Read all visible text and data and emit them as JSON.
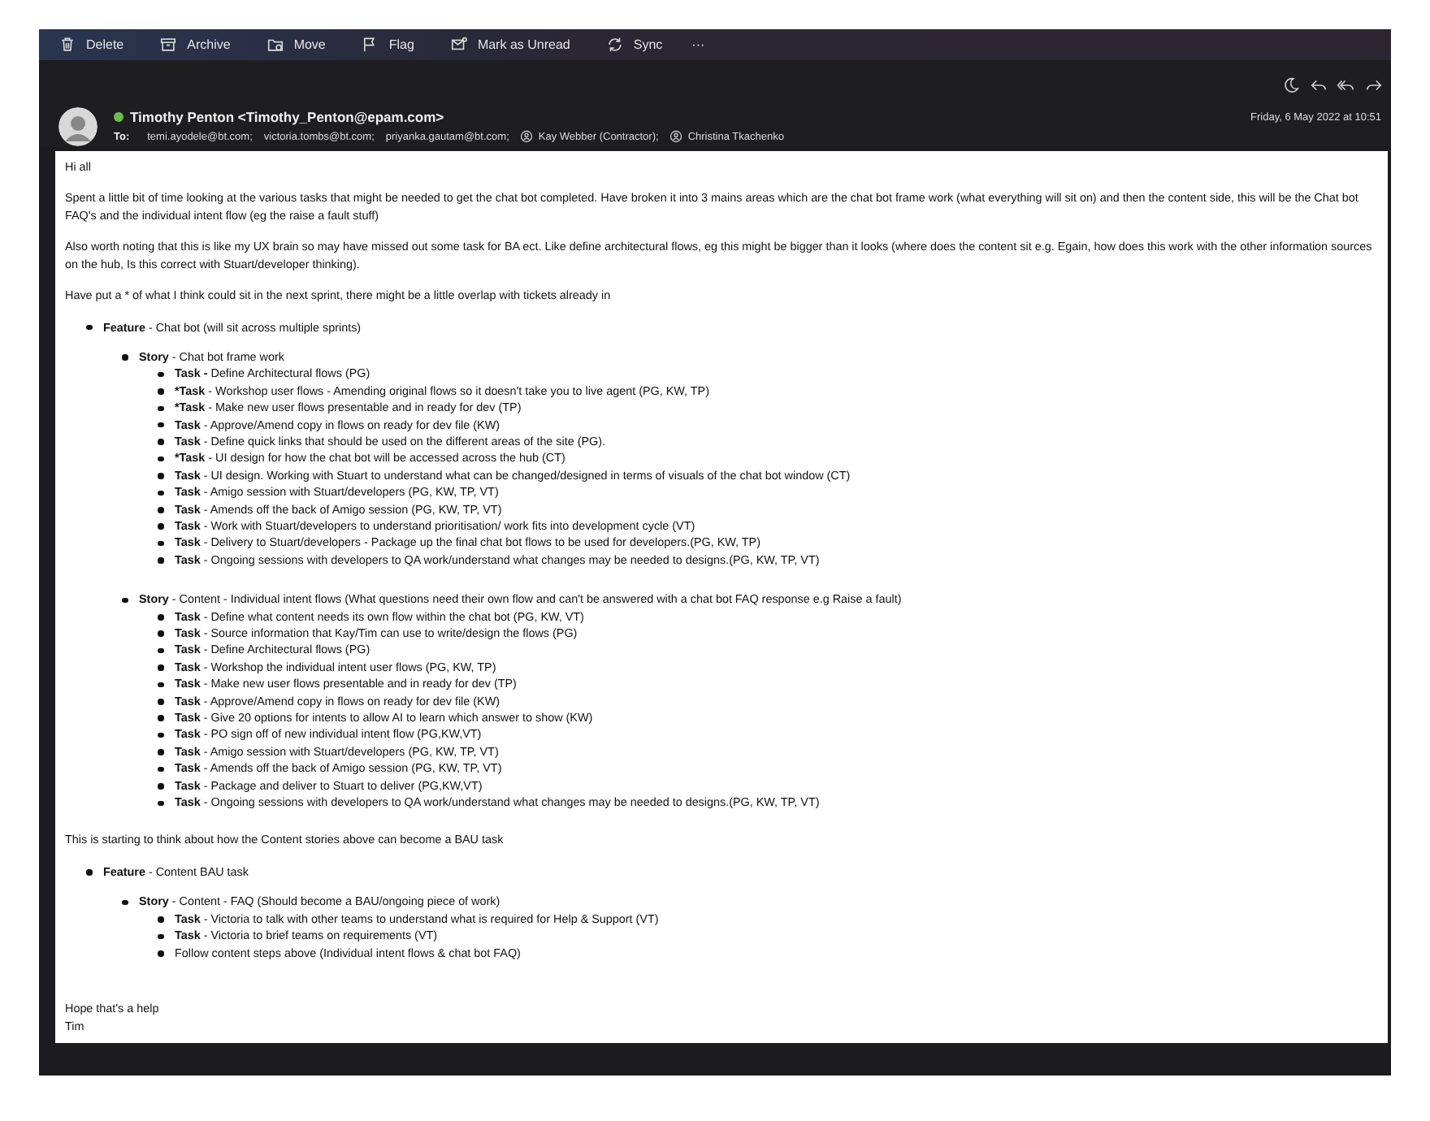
{
  "toolbar": [
    {
      "kind": "trash",
      "label": "Delete"
    },
    {
      "kind": "archive",
      "label": "Archive"
    },
    {
      "kind": "move",
      "label": "Move"
    },
    {
      "kind": "flag",
      "label": "Flag"
    },
    {
      "kind": "unread",
      "label": "Mark as Unread"
    },
    {
      "kind": "sync",
      "label": "Sync"
    },
    {
      "kind": "more",
      "label": "···"
    }
  ],
  "header": {
    "sender": "Timothy Penton <Timothy_Penton@epam.com>",
    "online": true,
    "to_label": "To:",
    "date": "Friday, 6 May 2022 at 10:51",
    "recipients": [
      {
        "kind": "email",
        "text": "temi.ayodele@bt.com;"
      },
      {
        "kind": "email",
        "text": "victoria.tombs@bt.com;"
      },
      {
        "kind": "email",
        "text": "priyanka.gautam@bt.com;"
      },
      {
        "kind": "contact",
        "text": "Kay Webber (Contractor);"
      },
      {
        "kind": "contact",
        "text": "Christina Tkachenko"
      }
    ],
    "actions": [
      {
        "kind": "snooze"
      },
      {
        "kind": "reply"
      },
      {
        "kind": "reply_all"
      },
      {
        "kind": "forward"
      }
    ]
  },
  "body": [
    {
      "kind": "paragraph",
      "text": "Hi all"
    },
    {
      "kind": "paragraph",
      "text": "Spent a little bit of time looking at the various tasks that might be needed to get the chat bot completed. Have broken it into 3 mains areas which are the chat bot frame work (what everything will sit on) and then the content side, this will be the Chat bot FAQ's and the individual intent flow (eg the raise a fault stuff)"
    },
    {
      "kind": "paragraph",
      "text": "Also worth noting that this is like my UX brain so may have missed out some task for BA ect. Like define architectural flows, eg this might be bigger than it looks (where does the content sit e.g. Egain, how does this work with the other information sources on the hub, Is this correct with Stuart/developer thinking)."
    },
    {
      "kind": "paragraph",
      "text": "Have put a * of what I think could sit in the next sprint, there might be a little overlap with tickets already in"
    },
    {
      "kind": "list",
      "items": [
        {
          "text": "**Feature** - Chat bot (will sit across multiple sprints)",
          "children": [
            {
              "text": "**Story** - Chat bot frame work",
              "children": [
                {
                  "text": "**Task -** Define Architectural flows (PG)"
                },
                {
                  "text": "***Task** - Workshop user flows - Amending original flows so it doesn't take you to live agent (PG, KW, TP)"
                },
                {
                  "text": "***Task** - Make new user flows presentable and in ready for dev (TP)"
                },
                {
                  "text": "**Task** - Approve/Amend copy in flows on ready for dev file (KW)"
                },
                {
                  "text": "**Task** - Define quick links that should be used on the different areas of the site (PG)."
                },
                {
                  "text": "***Task** - UI design for how the chat bot will be accessed across the hub (CT)"
                },
                {
                  "text": "**Task** - UI design. Working with Stuart to understand what can be changed/designed in terms of visuals of the chat bot window (CT)"
                },
                {
                  "text": "**Task** - Amigo session with Stuart/developers (PG, KW, TP, VT)"
                },
                {
                  "text": "**Task** - Amends off the back of Amigo session (PG, KW, TP, VT)"
                },
                {
                  "text": "**Task** - Work with Stuart/developers to understand prioritisation/ work fits into development cycle (VT)"
                },
                {
                  "text": "**Task** - Delivery to Stuart/developers - Package up the final chat bot flows to be used for developers.(PG, KW, TP)"
                },
                {
                  "text": "**Task** - Ongoing sessions with developers to QA work/understand what changes may be needed to designs.(PG, KW, TP, VT)"
                }
              ]
            },
            {
              "text": "**Story** -  Content - Individual intent flows (What questions need their own flow and can't be answered with a chat bot FAQ response e.g Raise a fault)",
              "children": [
                {
                  "text": "**Task** - Define what content needs its own flow within the chat bot (PG, KW, VT)"
                },
                {
                  "text": "**Task** - Source information that Kay/Tim can use to write/design the flows (PG)"
                },
                {
                  "text": "**Task** - Define Architectural flows (PG)"
                },
                {
                  "text": "**Task** - Workshop the individual intent user flows (PG, KW, TP)"
                },
                {
                  "text": "**Task** - Make new user flows presentable and in ready for dev (TP)"
                },
                {
                  "text": "**Task** - Approve/Amend copy in flows on ready for dev file (KW)"
                },
                {
                  "text": "**Task** - Give 20 options for intents to allow AI to learn which answer to show (KW)"
                },
                {
                  "text": "**Task** - PO sign off of new individual intent flow (PG,KW,VT)"
                },
                {
                  "text": "**Task** - Amigo session with Stuart/developers (PG, KW, TP, VT)"
                },
                {
                  "text": "**Task** - Amends off the back of Amigo session (PG, KW, TP, VT)"
                },
                {
                  "text": "**Task** - Package and deliver to Stuart to deliver (PG,KW,VT)"
                },
                {
                  "text": "**Task** - Ongoing sessions with developers to QA work/understand what changes may be needed to designs.(PG, KW, TP, VT)"
                }
              ]
            }
          ]
        }
      ]
    },
    {
      "kind": "paragraph",
      "text": "This is starting to think about how the Content stories above can become a BAU task"
    },
    {
      "kind": "list",
      "items": [
        {
          "text": "**Feature** - Content BAU task",
          "children": [
            {
              "text": "**Story** - Content - FAQ (Should become a BAU/ongoing piece of work)",
              "children": [
                {
                  "text": "**Task** - Victoria to talk with other teams to understand what is required for Help & Support (VT)"
                },
                {
                  "text": "**Task** - Victoria to brief teams on requirements (VT)"
                },
                {
                  "text": "Follow content steps above (Individual intent flows & chat bot FAQ)"
                }
              ]
            }
          ]
        }
      ]
    },
    {
      "kind": "closing",
      "text": "Hope that's a help"
    },
    {
      "kind": "line",
      "text": "Tim"
    }
  ]
}
